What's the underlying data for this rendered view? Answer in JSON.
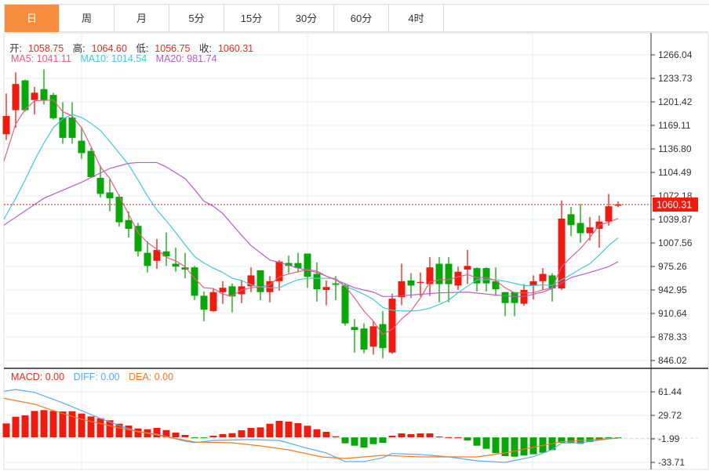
{
  "tabs": [
    {
      "label": "日",
      "active": true
    },
    {
      "label": "周"
    },
    {
      "label": "月"
    },
    {
      "label": "5分"
    },
    {
      "label": "15分"
    },
    {
      "label": "30分"
    },
    {
      "label": "60分"
    },
    {
      "label": "4时"
    }
  ],
  "ohlc_legend": {
    "open_label": "开:",
    "open": "1058.75",
    "high_label": "高:",
    "high": "1064.60",
    "low_label": "低:",
    "low": "1056.75",
    "close_label": "收:",
    "close": "1060.31"
  },
  "ma_legend": {
    "ma5": "MA5: 1041.11",
    "ma10": "MA10: 1014.54",
    "ma20": "MA20: 981.74"
  },
  "macd_legend": {
    "macd": "MACD: 0.00",
    "diff": "DIFF: 0.00",
    "dea": "DEA: 0.00"
  },
  "colors": {
    "up": "#f11a0e",
    "down": "#06a706",
    "ma5": "#ef5a85",
    "ma10": "#40c8e2",
    "ma20": "#b55ec9",
    "diff": "#5aaaf0",
    "dea": "#f57a20",
    "accent": "#f68c3e"
  },
  "chart_data": {
    "type": "candlestick",
    "price_axis": {
      "ticks": [
        "1266.04",
        "1233.73",
        "1201.42",
        "1169.11",
        "1136.80",
        "1104.49",
        "1072.18",
        "1039.87",
        "1007.56",
        "975.26",
        "942.95",
        "910.64",
        "878.33",
        "846.02"
      ],
      "range": [
        846.02,
        1266.04
      ]
    },
    "last_price": "1060.31",
    "candles": [
      [
        1157,
        1213,
        1149,
        1182
      ],
      [
        1190,
        1242,
        1166,
        1226
      ],
      [
        1231,
        1232,
        1188,
        1190
      ],
      [
        1204,
        1222,
        1184,
        1214
      ],
      [
        1219,
        1246,
        1198,
        1204
      ],
      [
        1211,
        1214,
        1177,
        1179
      ],
      [
        1180,
        1201,
        1144,
        1152
      ],
      [
        1180,
        1201,
        1144,
        1152
      ],
      [
        1148,
        1167,
        1123,
        1131
      ],
      [
        1134,
        1138,
        1097,
        1098
      ],
      [
        1097,
        1114,
        1070,
        1075
      ],
      [
        1077,
        1096,
        1051,
        1069
      ],
      [
        1071,
        1074,
        1030,
        1036
      ],
      [
        1039,
        1051,
        1015,
        1027
      ],
      [
        1031,
        1035,
        989,
        996
      ],
      [
        994,
        1010,
        967,
        976
      ],
      [
        983,
        1013,
        972,
        998
      ],
      [
        996,
        1022,
        976,
        989
      ],
      [
        979,
        1001,
        968,
        975
      ],
      [
        974,
        994,
        959,
        971
      ],
      [
        974,
        976,
        929,
        935
      ],
      [
        935,
        941,
        900,
        916
      ],
      [
        914,
        944,
        913,
        940
      ],
      [
        940,
        955,
        924,
        946
      ],
      [
        948,
        952,
        912,
        934
      ],
      [
        937,
        957,
        925,
        948
      ],
      [
        948,
        974,
        940,
        963
      ],
      [
        970,
        970,
        929,
        940
      ],
      [
        940,
        962,
        926,
        955
      ],
      [
        955,
        984,
        942,
        982
      ],
      [
        980,
        990,
        966,
        976
      ],
      [
        980,
        994,
        967,
        973
      ],
      [
        993,
        993,
        946,
        961
      ],
      [
        965,
        981,
        927,
        944
      ],
      [
        943,
        956,
        922,
        947
      ],
      [
        952,
        962,
        929,
        950
      ],
      [
        949,
        952,
        894,
        897
      ],
      [
        892,
        903,
        857,
        888
      ],
      [
        890,
        897,
        856,
        861
      ],
      [
        865,
        900,
        854,
        893
      ],
      [
        896,
        914,
        849,
        863
      ],
      [
        857,
        938,
        855,
        931
      ],
      [
        933,
        979,
        922,
        955
      ],
      [
        956,
        966,
        932,
        949
      ],
      [
        953,
        967,
        934,
        954
      ],
      [
        951,
        988,
        935,
        974
      ],
      [
        979,
        988,
        926,
        951
      ],
      [
        979,
        988,
        926,
        951
      ],
      [
        949,
        975,
        943,
        968
      ],
      [
        971,
        998,
        951,
        976
      ],
      [
        973,
        974,
        941,
        952
      ],
      [
        973,
        974,
        941,
        952
      ],
      [
        955,
        974,
        935,
        944
      ],
      [
        940,
        940,
        907,
        925
      ],
      [
        940,
        940,
        907,
        925
      ],
      [
        924,
        951,
        921,
        943
      ],
      [
        949,
        963,
        930,
        955
      ],
      [
        955,
        973,
        943,
        965
      ],
      [
        963,
        966,
        927,
        945
      ],
      [
        945,
        1066,
        943,
        1041
      ],
      [
        1047,
        1057,
        1017,
        1032
      ],
      [
        1035,
        1061,
        1008,
        1021
      ],
      [
        1021,
        1043,
        1011,
        1029
      ],
      [
        1027,
        1045,
        1001,
        1037
      ],
      [
        1037,
        1075,
        1031,
        1058
      ],
      [
        1058.75,
        1064.6,
        1056.75,
        1060.31
      ]
    ],
    "ma5": [
      [
        -0.25,
        1120
      ],
      [
        1,
        1171
      ],
      [
        2,
        1191
      ],
      [
        3,
        1203
      ],
      [
        5,
        1204
      ],
      [
        6,
        1188
      ],
      [
        7,
        1182
      ],
      [
        8,
        1166
      ],
      [
        9,
        1140
      ],
      [
        10,
        1112
      ],
      [
        11,
        1096
      ],
      [
        12,
        1072
      ],
      [
        13,
        1047
      ],
      [
        14,
        1022
      ],
      [
        15,
        1008
      ],
      [
        16,
        999
      ],
      [
        17,
        988
      ],
      [
        18,
        983
      ],
      [
        19,
        975
      ],
      [
        20,
        959
      ],
      [
        21,
        946
      ],
      [
        22,
        945
      ],
      [
        23,
        937
      ],
      [
        24,
        935
      ],
      [
        25,
        943
      ],
      [
        26,
        946
      ],
      [
        27,
        947
      ],
      [
        28,
        950
      ],
      [
        29,
        961
      ],
      [
        30,
        965
      ],
      [
        31,
        968
      ],
      [
        32,
        971
      ],
      [
        33,
        969
      ],
      [
        34,
        962
      ],
      [
        35,
        957
      ],
      [
        36,
        948
      ],
      [
        37,
        932
      ],
      [
        38,
        914
      ],
      [
        39,
        900
      ],
      [
        40,
        882
      ],
      [
        41,
        889
      ],
      [
        42,
        903
      ],
      [
        43,
        914
      ],
      [
        44,
        932
      ],
      [
        45,
        954
      ],
      [
        46,
        957
      ],
      [
        47,
        957
      ],
      [
        48,
        961
      ],
      [
        49,
        964
      ],
      [
        50,
        960
      ],
      [
        51,
        960
      ],
      [
        52,
        956
      ],
      [
        53,
        946
      ],
      [
        54,
        939
      ],
      [
        55,
        939
      ],
      [
        56,
        939
      ],
      [
        57,
        943
      ],
      [
        58,
        946
      ],
      [
        59,
        975
      ],
      [
        60,
        988
      ],
      [
        61,
        1000
      ],
      [
        62,
        1015
      ],
      [
        63,
        1032
      ],
      [
        64,
        1036
      ],
      [
        65,
        1041.11
      ]
    ],
    "ma10": [
      [
        -0.25,
        1040
      ],
      [
        1,
        1069
      ],
      [
        2,
        1094
      ],
      [
        3,
        1121
      ],
      [
        4,
        1145
      ],
      [
        5,
        1166
      ],
      [
        6,
        1178
      ],
      [
        7,
        1184
      ],
      [
        8,
        1180
      ],
      [
        9,
        1172
      ],
      [
        10,
        1162
      ],
      [
        11,
        1147
      ],
      [
        12,
        1131
      ],
      [
        13,
        1115
      ],
      [
        14,
        1094
      ],
      [
        15,
        1072
      ],
      [
        16,
        1053
      ],
      [
        17,
        1038
      ],
      [
        18,
        1022
      ],
      [
        19,
        1005
      ],
      [
        20,
        989
      ],
      [
        21,
        980
      ],
      [
        22,
        973
      ],
      [
        23,
        967
      ],
      [
        24,
        959
      ],
      [
        25,
        956
      ],
      [
        26,
        950
      ],
      [
        27,
        947
      ],
      [
        28,
        946
      ],
      [
        29,
        946
      ],
      [
        30,
        952
      ],
      [
        31,
        957
      ],
      [
        32,
        959
      ],
      [
        35,
        959
      ],
      [
        36,
        948
      ],
      [
        37,
        943
      ],
      [
        38,
        937
      ],
      [
        39,
        930
      ],
      [
        40,
        919
      ],
      [
        41,
        915
      ],
      [
        42,
        914
      ],
      [
        43,
        914
      ],
      [
        44,
        915
      ],
      [
        45,
        918
      ],
      [
        46,
        923
      ],
      [
        47,
        929
      ],
      [
        48,
        939
      ],
      [
        49,
        948
      ],
      [
        50,
        957
      ],
      [
        52,
        957
      ],
      [
        53,
        955
      ],
      [
        54,
        952
      ],
      [
        55,
        949
      ],
      [
        56,
        949
      ],
      [
        57,
        950
      ],
      [
        58,
        949
      ],
      [
        59,
        957
      ],
      [
        60,
        964
      ],
      [
        61,
        972
      ],
      [
        62,
        979
      ],
      [
        63,
        991
      ],
      [
        64,
        1004
      ],
      [
        65,
        1014.54
      ]
    ],
    "ma20": [
      [
        -0.25,
        1032
      ],
      [
        4,
        1069
      ],
      [
        8,
        1091
      ],
      [
        11,
        1110
      ],
      [
        13,
        1117
      ],
      [
        14,
        1118
      ],
      [
        16,
        1118
      ],
      [
        17,
        1112
      ],
      [
        19,
        1096
      ],
      [
        20,
        1081
      ],
      [
        21,
        1065
      ],
      [
        22,
        1058
      ],
      [
        23,
        1048
      ],
      [
        24,
        1033
      ],
      [
        25,
        1018
      ],
      [
        26,
        1004
      ],
      [
        28,
        984
      ],
      [
        29,
        981
      ],
      [
        31,
        973
      ],
      [
        33,
        967
      ],
      [
        35,
        957
      ],
      [
        37,
        946
      ],
      [
        39,
        940
      ],
      [
        40,
        934
      ],
      [
        41,
        934
      ],
      [
        43,
        936
      ],
      [
        44,
        937
      ],
      [
        46,
        939
      ],
      [
        49,
        940
      ],
      [
        52,
        936
      ],
      [
        54,
        934
      ],
      [
        55,
        934
      ],
      [
        57,
        940
      ],
      [
        58,
        945
      ],
      [
        60,
        960
      ],
      [
        62,
        967
      ],
      [
        64,
        975
      ],
      [
        65,
        981.74
      ]
    ],
    "macd_axis": {
      "ticks": [
        "61.44",
        "29.72",
        "-1.99",
        "-33.71"
      ],
      "range": [
        -33.71,
        61.44
      ]
    },
    "macd_hist": [
      18.8,
      27.9,
      29.7,
      35.7,
      36.8,
      35.7,
      35.0,
      35.3,
      32.2,
      28.3,
      25.8,
      23.1,
      18.4,
      16.0,
      12.1,
      11.0,
      12.8,
      9.9,
      6.5,
      3.3,
      -0.5,
      -0.5,
      2.2,
      4.4,
      5.7,
      9.6,
      12.8,
      13.5,
      18.4,
      22.3,
      21.3,
      19.2,
      15.7,
      11.0,
      7.5,
      1.5,
      -8.0,
      -11.2,
      -13.6,
      -9.1,
      -7.3,
      2.2,
      5.4,
      4.4,
      5.4,
      5.4,
      1.2,
      0.3,
      0.2,
      -4.1,
      -11.2,
      -15.4,
      -21.3,
      -25.2,
      -26.0,
      -24.5,
      -22.8,
      -20.7,
      -17.1,
      -7.3,
      -7.3,
      -8.6,
      -6.2,
      -3.8,
      -1.2,
      -0.8
    ],
    "diff": [
      [
        -0.25,
        62.2
      ],
      [
        1,
        64.6
      ],
      [
        3,
        60.7
      ],
      [
        6,
        46.6
      ],
      [
        8,
        36.1
      ],
      [
        10,
        25.5
      ],
      [
        12,
        16.0
      ],
      [
        14,
        7.5
      ],
      [
        16,
        4.4
      ],
      [
        19,
        -5.2
      ],
      [
        20,
        -7.0
      ],
      [
        22,
        -4.1
      ],
      [
        26,
        -3.0
      ],
      [
        29,
        -4.1
      ],
      [
        32,
        -14.7
      ],
      [
        34,
        -21.0
      ],
      [
        36,
        -32.6
      ],
      [
        38,
        -32.6
      ],
      [
        40,
        -27.4
      ],
      [
        41,
        -21.8
      ],
      [
        44,
        -23.1
      ],
      [
        47,
        -26.3
      ],
      [
        50,
        -31.6
      ],
      [
        53,
        -33.7
      ],
      [
        56,
        -26.0
      ],
      [
        58,
        -16.5
      ],
      [
        59,
        -7.6
      ],
      [
        61,
        -7.3
      ],
      [
        64,
        -2.0
      ],
      [
        65,
        -0.9
      ]
    ],
    "dea": [
      [
        -0.25,
        52.7
      ],
      [
        3,
        44.8
      ],
      [
        5,
        36.1
      ],
      [
        8,
        24.4
      ],
      [
        12,
        12.8
      ],
      [
        16,
        3.3
      ],
      [
        20,
        -6.2
      ],
      [
        24,
        -7.3
      ],
      [
        27,
        -11.5
      ],
      [
        30,
        -16.8
      ],
      [
        33.5,
        -26.3
      ],
      [
        36,
        -28.4
      ],
      [
        40,
        -24.2
      ],
      [
        44,
        -26.3
      ],
      [
        50,
        -26.3
      ],
      [
        53,
        -21.0
      ],
      [
        56,
        -13.3
      ],
      [
        59,
        -5.9
      ],
      [
        62,
        -3.4
      ],
      [
        65,
        -0.9
      ]
    ]
  }
}
